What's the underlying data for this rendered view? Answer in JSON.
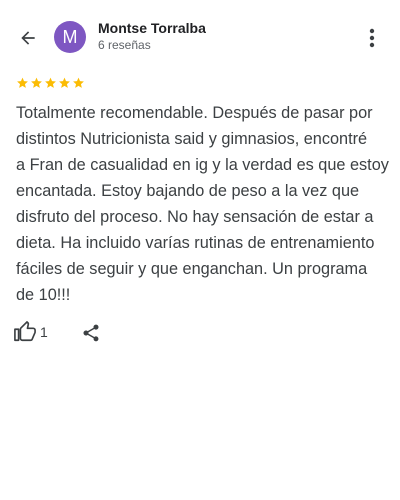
{
  "reviewer": {
    "initial": "M",
    "name": "Montse Torralba",
    "review_count": "6 reseñas",
    "avatar_color": "#7e57c2"
  },
  "rating": {
    "stars": 5,
    "max": 5,
    "star_color": "#fbbc04"
  },
  "review": {
    "lines": [
      "Totalmente recomendable. Después de pasar por",
      "distintos Nutricionista said y gimnasios, encontré",
      "a Fran de casualidad en ig y la verdad es que estoy",
      "encantada. Estoy bajando de peso a la vez que",
      "disfruto del proceso. No hay sensación de estar a",
      "dieta. Ha incluido varías rutinas de entrenamiento",
      "fáciles de seguir y que enganchan. Un programa",
      "de 10!!!"
    ]
  },
  "actions": {
    "like_count": "1"
  },
  "icons": {
    "back": "arrow-back-icon",
    "more": "more-vert-icon",
    "like": "thumb-up-icon",
    "share": "share-icon",
    "star": "star-icon"
  }
}
